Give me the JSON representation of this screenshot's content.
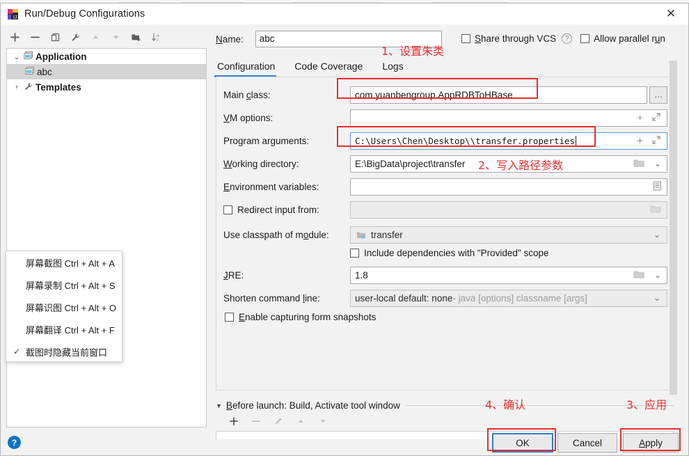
{
  "window": {
    "title": "Run/Debug Configurations",
    "app_icon": "intellij-idea-icon",
    "close_label": "✕"
  },
  "toolbar": {
    "buttons": [
      {
        "name": "add-configuration-button",
        "glyph": "+"
      },
      {
        "name": "remove-configuration-button",
        "glyph": "−"
      },
      {
        "name": "copy-configuration-button",
        "glyph": "copy-icon"
      },
      {
        "name": "edit-templates-button",
        "glyph": "wrench-icon"
      },
      {
        "name": "move-up-button",
        "glyph": "triangle-up-icon"
      },
      {
        "name": "move-down-button",
        "glyph": "triangle-down-icon"
      },
      {
        "name": "new-folder-button",
        "glyph": "folder-add-icon"
      },
      {
        "name": "sort-alphabetically-button",
        "glyph": "sort-az-icon"
      }
    ]
  },
  "tree": {
    "nodes": [
      {
        "label": "Application",
        "twisty": "⌄",
        "icon": "application-icon",
        "bold": true,
        "selected": false,
        "indent": 0
      },
      {
        "label": "abc",
        "twisty": "",
        "icon": "application-icon",
        "bold": false,
        "selected": true,
        "indent": 1
      },
      {
        "label": "Templates",
        "twisty": "›",
        "icon": "wrench-icon",
        "bold": true,
        "selected": false,
        "indent": 0
      }
    ]
  },
  "name_row": {
    "label": "Name:",
    "value": "abc",
    "placeholder": ""
  },
  "options": {
    "share_vcs_label": "Share through VCS",
    "share_vcs_checked": false,
    "help_glyph": "?",
    "allow_parallel_label": "Allow parallel run",
    "allow_parallel_checked": false
  },
  "tabs": [
    {
      "label": "Configuration",
      "active": true
    },
    {
      "label": "Code Coverage",
      "active": false
    },
    {
      "label": "Logs",
      "active": false
    }
  ],
  "fields": {
    "main_class": {
      "label": "Main class:",
      "value": "com.yuanbengroup.AppRDBToHBase",
      "browse_glyph": "…"
    },
    "vm_options": {
      "label": "VM options:",
      "value": "",
      "add_glyph": "+",
      "expand_glyph": "expand-icon"
    },
    "program_arguments": {
      "label": "Program arguments:",
      "value": "C:\\Users\\Chen\\Desktop\\\\transfer.properties",
      "add_glyph": "+",
      "expand_glyph": "expand-icon"
    },
    "working_directory": {
      "label": "Working directory:",
      "value": "E:\\BigData\\project\\transfer",
      "folder_glyph": "folder-icon",
      "chevron_glyph": "⌄"
    },
    "environment_variables": {
      "label": "Environment variables:",
      "value": "",
      "editor_glyph": "list-editor-icon"
    },
    "redirect_input": {
      "label": "Redirect input from:",
      "checked": false,
      "value": "",
      "folder_glyph": "folder-icon"
    },
    "use_classpath_of_module": {
      "label": "Use classpath of module:",
      "value": "transfer",
      "module_icon": "module-icon",
      "chevron_glyph": "⌄"
    },
    "include_dependencies": {
      "label": "Include dependencies with \"Provided\" scope",
      "checked": false
    },
    "jre": {
      "label": "JRE:",
      "value": "1.8",
      "folder_glyph": "folder-icon",
      "chevron_glyph": "⌄"
    },
    "shorten_command_line": {
      "label": "Shorten command line:",
      "value": "user-local default: none",
      "hint": " - java [options] classname [args]",
      "chevron_glyph": "⌄"
    },
    "enable_capturing": {
      "label": "Enable capturing form snapshots",
      "checked": false
    }
  },
  "before_launch": {
    "title": "Before launch: Build, Activate tool window",
    "triangle": "▼",
    "buttons": [
      {
        "name": "before-launch-add-button",
        "glyph": "+"
      },
      {
        "name": "before-launch-remove-button",
        "glyph": "−"
      },
      {
        "name": "before-launch-edit-button",
        "glyph": "pencil-icon"
      },
      {
        "name": "before-launch-move-up-button",
        "glyph": "triangle-up-icon"
      },
      {
        "name": "before-launch-move-down-button",
        "glyph": "triangle-down-icon"
      }
    ]
  },
  "dialog_buttons": {
    "ok": "OK",
    "cancel": "Cancel",
    "apply": "Apply",
    "help": "?"
  },
  "annotations": [
    {
      "text": "1、设置朱类",
      "name": "annotation-step-1"
    },
    {
      "text": "2、写入路径参数",
      "name": "annotation-step-2"
    },
    {
      "text": "3、应用",
      "name": "annotation-step-3"
    },
    {
      "text": "4、确认",
      "name": "annotation-step-4"
    }
  ],
  "context_menu": {
    "items": [
      {
        "check": "",
        "text": "屏幕截图 Ctrl + Alt + A"
      },
      {
        "check": "",
        "text": "屏幕录制 Ctrl + Alt + S"
      },
      {
        "check": "",
        "text": "屏幕识图 Ctrl + Alt + O"
      },
      {
        "check": "",
        "text": "屏幕翻译 Ctrl + Alt + F"
      },
      {
        "check": "✓",
        "text": "截图时隐藏当前窗口"
      }
    ]
  },
  "colors": {
    "annotation_red": "#ee2b2b",
    "accent_blue": "#3d86d6",
    "focus_blue": "#2a7fd4",
    "selection_grey": "#d4d4d4"
  }
}
